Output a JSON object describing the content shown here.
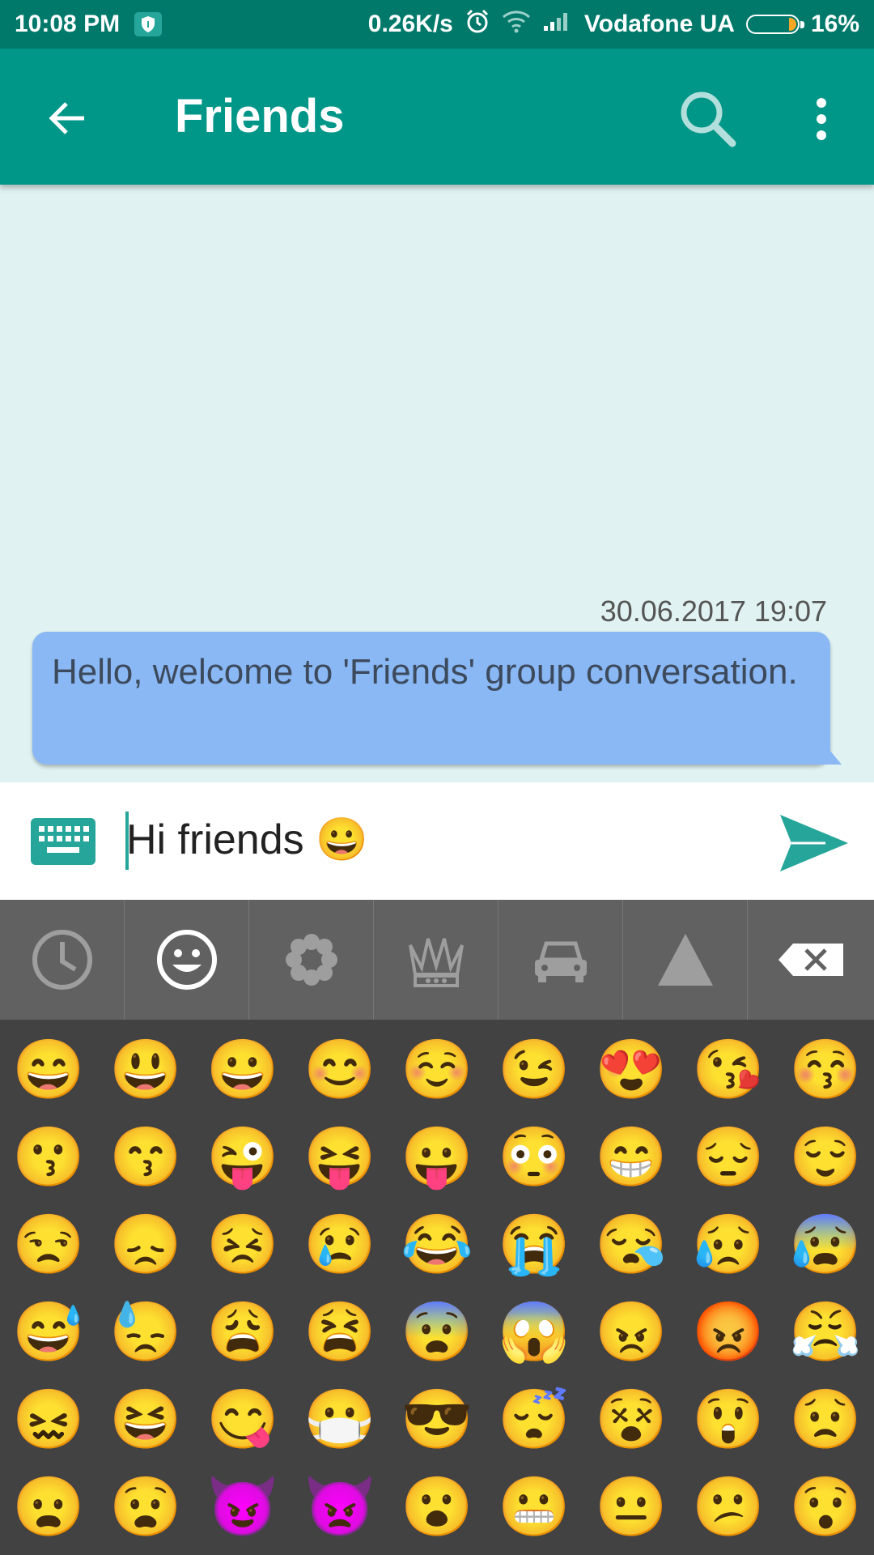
{
  "status_bar": {
    "time": "10:08 PM",
    "net_speed": "0.26K/s",
    "carrier": "Vodafone UA",
    "battery": "16%",
    "battery_level": 0.16
  },
  "app_bar": {
    "title": "Friends",
    "back_icon": "arrow-left-icon",
    "search_icon": "search-icon",
    "more_icon": "more-vert-icon"
  },
  "chat": {
    "messages": [
      {
        "timestamp": "30.06.2017 19:07",
        "text": "Hello, welcome to 'Friends' group conversation."
      }
    ]
  },
  "composer": {
    "text": "Hi friends 😀",
    "placeholder": "",
    "keyboard_icon": "keyboard-icon",
    "send_icon": "send-icon"
  },
  "emoji_keyboard": {
    "categories": [
      {
        "name": "recent",
        "icon": "clock-icon",
        "selected": false
      },
      {
        "name": "people",
        "icon": "smiley-icon",
        "selected": true
      },
      {
        "name": "nature",
        "icon": "flower-icon",
        "selected": false
      },
      {
        "name": "objects",
        "icon": "crown-icon",
        "selected": false
      },
      {
        "name": "places",
        "icon": "car-icon",
        "selected": false
      },
      {
        "name": "symbols",
        "icon": "triangle-icon",
        "selected": false
      },
      {
        "name": "backspace",
        "icon": "backspace-icon",
        "selected": false
      }
    ],
    "emojis": [
      "😄",
      "😃",
      "😀",
      "😊",
      "☺️",
      "😉",
      "😍",
      "😘",
      "😚",
      "😗",
      "😙",
      "😜",
      "😝",
      "😛",
      "😳",
      "😁",
      "😔",
      "😌",
      "😒",
      "😞",
      "😣",
      "😢",
      "😂",
      "😭",
      "😪",
      "😥",
      "😰",
      "😅",
      "😓",
      "😩",
      "😫",
      "😨",
      "😱",
      "😠",
      "😡",
      "😤",
      "😖",
      "😆",
      "😋",
      "😷",
      "😎",
      "😴",
      "😵",
      "😲",
      "😟",
      "😦",
      "😧",
      "😈",
      "👿",
      "😮",
      "😬",
      "😐",
      "😕",
      "😯"
    ]
  },
  "colors": {
    "status_bar": "#00796b",
    "app_bar": "#009688",
    "accent": "#26a69a",
    "chat_background": "#e0f2f1",
    "bubble": "#8ab8f5"
  }
}
